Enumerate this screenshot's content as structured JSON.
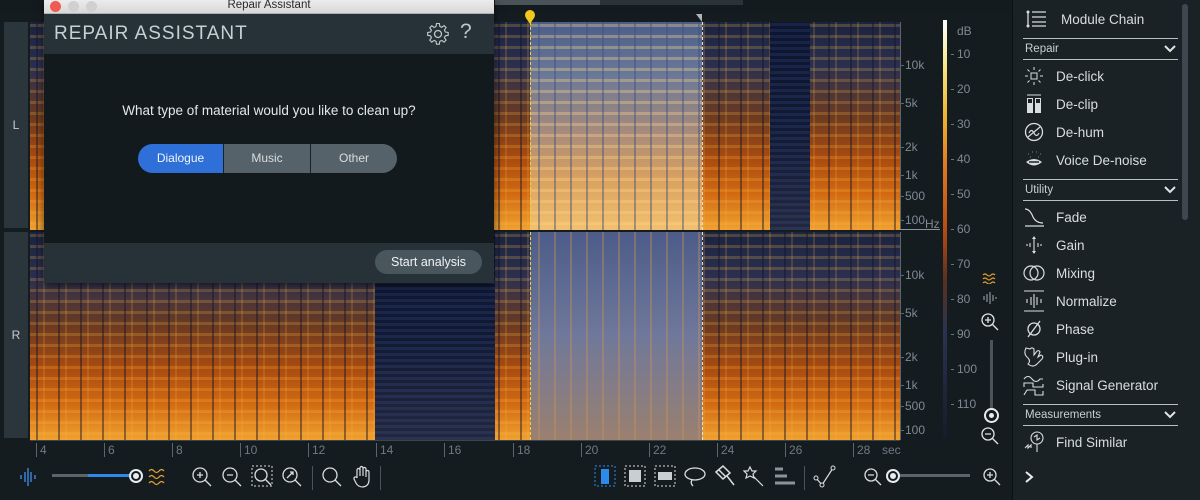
{
  "repair_assistant": {
    "window_title": "Repair Assistant",
    "heading": "REPAIR ASSISTANT",
    "question": "What type of material would you like to clean up?",
    "material_options": [
      {
        "label": "Dialogue",
        "selected": true
      },
      {
        "label": "Music",
        "selected": false
      },
      {
        "label": "Other",
        "selected": false
      }
    ],
    "start_button": "Start analysis",
    "icons": {
      "settings": "gear-icon",
      "help": "question-icon"
    }
  },
  "channels": {
    "left": "L",
    "right": "R"
  },
  "frequency_axis": {
    "ticks": [
      "10k",
      "5k",
      "2k",
      "1k",
      "500",
      "100"
    ],
    "unit": "Hz"
  },
  "db_scale": {
    "unit": "dB",
    "ticks": [
      "10",
      "20",
      "30",
      "40",
      "50",
      "60",
      "70",
      "80",
      "90",
      "100",
      "110"
    ]
  },
  "time_axis": {
    "ticks": [
      "4",
      "6",
      "8",
      "10",
      "12",
      "14",
      "16",
      "18",
      "20",
      "22",
      "24",
      "26",
      "28"
    ],
    "unit": "sec"
  },
  "selection": {
    "start_sec": 18.3,
    "end_sec": 23.4
  },
  "waveform_spectrogram_blend": 1.0,
  "horizontal_zoom_level": 0.0,
  "vertical_zoom_level": 0.0,
  "module_panel": {
    "module_chain": "Module Chain",
    "sections": [
      {
        "label": "Repair",
        "items": [
          {
            "label": "De-click",
            "icon": "declick-icon"
          },
          {
            "label": "De-clip",
            "icon": "declip-icon"
          },
          {
            "label": "De-hum",
            "icon": "dehum-icon"
          },
          {
            "label": "Voice De-noise",
            "icon": "voice-denoise-icon"
          }
        ]
      },
      {
        "label": "Utility",
        "items": [
          {
            "label": "Fade",
            "icon": "fade-icon"
          },
          {
            "label": "Gain",
            "icon": "gain-icon"
          },
          {
            "label": "Mixing",
            "icon": "mixing-icon"
          },
          {
            "label": "Normalize",
            "icon": "normalize-icon"
          },
          {
            "label": "Phase",
            "icon": "phase-icon"
          },
          {
            "label": "Plug-in",
            "icon": "plugin-icon"
          },
          {
            "label": "Signal Generator",
            "icon": "signal-generator-icon"
          }
        ]
      },
      {
        "label": "Measurements",
        "items": [
          {
            "label": "Find Similar",
            "icon": "find-similar-icon"
          }
        ]
      }
    ]
  },
  "colors": {
    "accent": "#2f6fd8",
    "playhead": "#f2c81c",
    "background": "#151c20"
  }
}
